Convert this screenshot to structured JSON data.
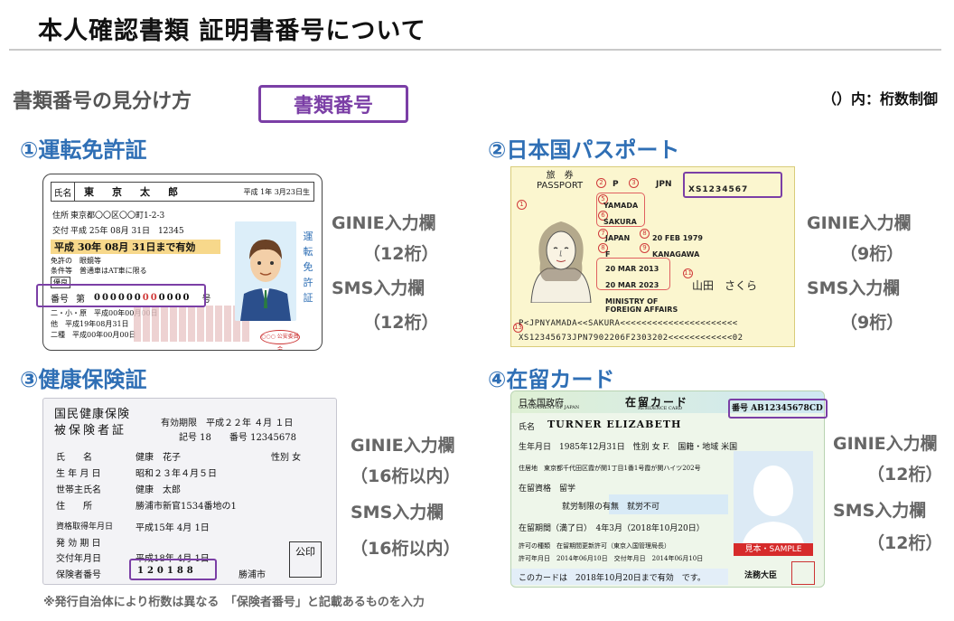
{
  "header": {
    "title": "本人確認書類 証明書番号について"
  },
  "legend": {
    "howto": "書類番号の見分け方",
    "box_label": "書類番号",
    "digits_note": "（）内：桁数制御"
  },
  "sections": {
    "license": {
      "title": "①運転免許証",
      "ginie_label": "GINIE入力欄",
      "ginie_digits": "（12桁）",
      "sms_label": "SMS入力欄",
      "sms_digits": "（12桁）"
    },
    "passport": {
      "title": "②日本国パスポート",
      "ginie_label": "GINIE入力欄",
      "ginie_digits": "（9桁）",
      "sms_label": "SMS入力欄",
      "sms_digits": "（9桁）"
    },
    "health": {
      "title": "③健康保険証",
      "ginie_label": "GINIE入力欄",
      "ginie_digits": "（16桁以内）",
      "sms_label": "SMS入力欄",
      "sms_digits": "（16桁以内）"
    },
    "residence": {
      "title": "④在留カード",
      "ginie_label": "GINIE入力欄",
      "ginie_digits": "（12桁）",
      "sms_label": "SMS入力欄",
      "sms_digits": "（12桁）"
    }
  },
  "license_card": {
    "name_label": "氏名",
    "name": "東京太郎",
    "dob": "平成 1年 3月23日生",
    "address_label": "住所",
    "address": "東京都〇〇区〇〇町1-2-3",
    "issue_label": "交付",
    "issue": "平成 25年 08月 31日　12345",
    "expiry": "平成 30年 08月 31日まで有効",
    "cond_line1": "免許の　眼鏡等",
    "cond_line2": "条件等　普通車はAT車に限る",
    "tag": "優良",
    "number_label": "番号",
    "number_prefix": "第",
    "number_a": "000000",
    "number_b": "00",
    "number_c": "0000",
    "number_suffix": "号",
    "hist1": "二・小・原　平成00年00月00日",
    "hist2": "他　平成19年08月31日",
    "hist3": "二種　平成00年00月00日",
    "side_text": "運転免許証",
    "seal": "○○○ 公安委員会"
  },
  "passport_card": {
    "header_jp": "旅　券",
    "header_en": "PASSPORT",
    "type": "P",
    "country": "JPN",
    "number": "XS1234567",
    "surname": "YAMADA",
    "given_name": "SAKURA",
    "nationality": "JAPAN",
    "dob": "20 FEB 1979",
    "sex": "F",
    "domicile": "KANAGAWA",
    "issue_date": "20 MAR 2013",
    "expiry_date": "20 MAR 2023",
    "authority_1": "MINISTRY OF",
    "authority_2": "FOREIGN AFFAIRS",
    "signature": "山田　さくら",
    "mrz1": "P<JPNYAMADA<<SAKURA<<<<<<<<<<<<<<<<<<<<<<",
    "mrz2": "XS12345673JPN7902206F2303202<<<<<<<<<<<<02"
  },
  "health_card": {
    "title1": "国民健康保険",
    "title2": "被保険者証",
    "valid": "有効期限　平成２２年 ４月 １日",
    "symbol": "記号 18　　番号 12345678",
    "name_label": "氏　　名",
    "name": "健康　花子",
    "sex": "性別 女",
    "dob_label": "生 年 月 日",
    "dob": "昭和２３年４月５日",
    "head_label": "世帯主氏名",
    "head": "健康　太郎",
    "addr_label": "住　　所",
    "addr": "勝浦市新官1534番地の1",
    "acq_label": "資格取得年月日",
    "acq": "平成15年 4月 1日",
    "eff_label": "発 効 期 日",
    "issue_label": "交付年月日",
    "issue": "平成18年 4月 1日",
    "insurer_label": "保険者番号",
    "insurer": "120188",
    "city": "勝浦市",
    "stamp": "公印"
  },
  "residence_card": {
    "gov": "日本国政府",
    "gov_en": "GOVERNMENT OF JAPAN",
    "title": "在留カード",
    "title_en": "RESIDENCE CARD",
    "number": "番号 AB12345678CD",
    "name_label": "氏名",
    "name": "TURNER ELIZABETH",
    "dob_row": "生年月日　1985年12月31日　性別 女 F.　国籍・地域 米国",
    "address": "住居地　東京都千代田区霞が関1丁目1番1号霞が関ハイツ202号",
    "status": "在留資格　留学",
    "work": "就労制限の有無　就労不可",
    "period": "在留期間（満了日）　4年3月（2018年10月20日）",
    "permit": "許可の種類　在留期間更新許可（東京入国管理局長）",
    "permit_date": "許可年月日　2014年06月10日　交付年月日　2014年06月10日",
    "expiry": "このカードは　2018年10月20日まで有効　です。",
    "sample": "見本・SAMPLE",
    "minister": "法務大臣"
  },
  "footnote": "※発行自治体により桁数は異なる　「保険者番号」と記載あるものを入力",
  "colors": {
    "accent_purple": "#7b3fa6",
    "section_blue": "#2f6fb5"
  }
}
